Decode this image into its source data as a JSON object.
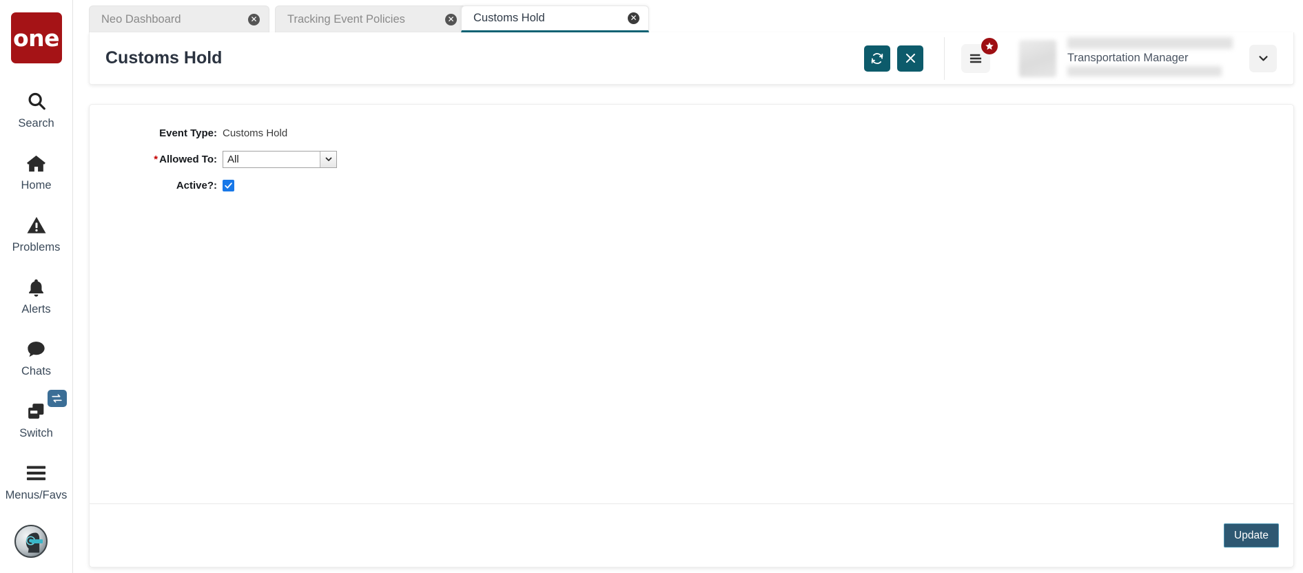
{
  "brand": {
    "logo_text": "one",
    "logo_color": "#a51316"
  },
  "sidebar": {
    "items": [
      {
        "label": "Search",
        "icon": "search-icon"
      },
      {
        "label": "Home",
        "icon": "home-icon"
      },
      {
        "label": "Problems",
        "icon": "warning-triangle-icon"
      },
      {
        "label": "Alerts",
        "icon": "bell-icon"
      },
      {
        "label": "Chats",
        "icon": "chat-bubble-icon"
      },
      {
        "label": "Switch",
        "icon": "copy-windows-icon",
        "badge_icon": "exchange-arrows-icon"
      },
      {
        "label": "Menus/Favs",
        "icon": "hamburger-icon"
      }
    ],
    "assistant": {
      "icon": "ai-bot-avatar-icon"
    }
  },
  "tabs": [
    {
      "label": "Neo Dashboard",
      "active": false,
      "close_icon": "close-circle-icon"
    },
    {
      "label": "Tracking Event Policies",
      "active": false,
      "close_icon": "close-circle-icon"
    },
    {
      "label": "Customs Hold",
      "active": true,
      "close_icon": "close-circle-icon"
    }
  ],
  "header": {
    "title": "Customs Hold",
    "refresh_icon": "refresh-icon",
    "close_icon": "close-x-icon",
    "menu_icon": "menu-lines-icon",
    "favorites_badge_icon": "star-icon",
    "accent_color": "#0d5b6b",
    "badge_color": "#9e0f13"
  },
  "user": {
    "role": "Transportation Manager",
    "caret_icon": "chevron-down-icon",
    "avatar_icon": "user-avatar"
  },
  "form": {
    "rows": [
      {
        "label": "Event Type:",
        "type": "text",
        "value": "Customs Hold",
        "required": false
      },
      {
        "label": "Allowed To:",
        "type": "select",
        "value": "All",
        "required": true,
        "arrow_icon": "chevron-down-icon"
      },
      {
        "label": "Active?:",
        "type": "checkbox",
        "checked": true,
        "required": false,
        "check_icon": "checkmark-icon"
      }
    ]
  },
  "footer": {
    "update_label": "Update",
    "button_color": "#2e5872"
  }
}
